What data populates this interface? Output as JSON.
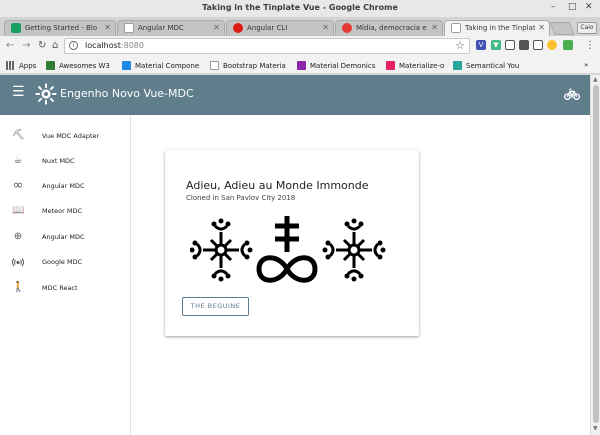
{
  "window": {
    "title": "Taking in the Tinplate Vue - Google Chrome",
    "profile_label": "Caio"
  },
  "tabs": [
    {
      "label": "Getting Started - Blo",
      "favicon_color": "#17a05d",
      "active": false
    },
    {
      "label": "Angular MDC",
      "favicon_color": "#9e9e9e",
      "active": false
    },
    {
      "label": "Angular CLI",
      "favicon_color": "#dd1b16",
      "active": false
    },
    {
      "label": "Mídia, democracia e",
      "favicon_color": "#e53935",
      "active": false
    },
    {
      "label": "Taking in the Tinplat",
      "favicon_color": "#9e9e9e",
      "active": true
    }
  ],
  "toolbar": {
    "url_host": "localhost",
    "url_port": ":8080"
  },
  "bookmarks": [
    {
      "label": "Apps",
      "color": "#666"
    },
    {
      "label": "Awesomes W3",
      "color": "#2e7d32"
    },
    {
      "label": "Material Compone",
      "color": "#1e88e5"
    },
    {
      "label": "Bootstrap Materia",
      "color": "#9e9e9e"
    },
    {
      "label": "Material Demonics",
      "color": "#8e24aa"
    },
    {
      "label": "Materialize-o",
      "color": "#e91e63"
    },
    {
      "label": "Semantical You",
      "color": "#26a69a"
    }
  ],
  "app": {
    "title": "Engenho Novo Vue-MDC",
    "accent_color": "#607d8b"
  },
  "drawer": {
    "items": [
      {
        "label": "Vue MDC Adapter",
        "icon": "pick-icon"
      },
      {
        "label": "Nuxt MDC",
        "icon": "coffee-icon"
      },
      {
        "label": "Angular MDC",
        "icon": "infinity-icon"
      },
      {
        "label": "Meteor MDC",
        "icon": "book-icon"
      },
      {
        "label": "Angular MDC",
        "icon": "gps-icon"
      },
      {
        "label": "Google MDC",
        "icon": "wifi-tethering-icon"
      },
      {
        "label": "MDC React",
        "icon": "walk-icon"
      }
    ]
  },
  "card": {
    "title": "Adieu, Adieu au Monde Immonde",
    "subtitle": "Cloned in San Pavlov City 2018",
    "button_label": "THE BEGUINE"
  }
}
